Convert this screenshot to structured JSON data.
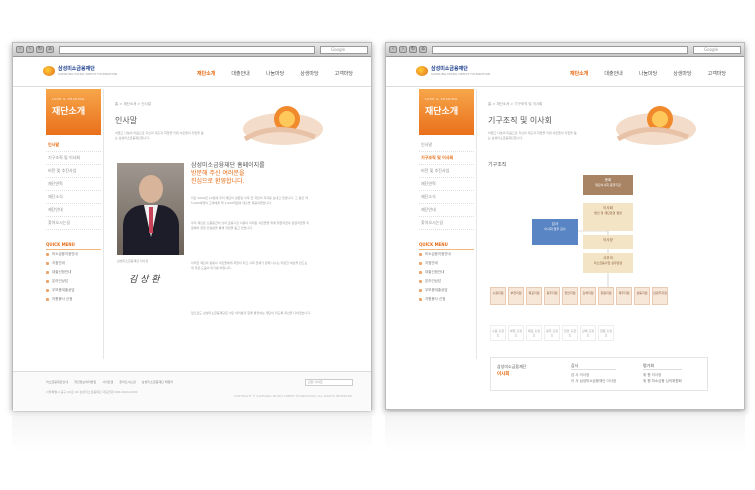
{
  "browser": {
    "search_placeholder": "Google"
  },
  "site": {
    "logo_name": "삼성미소금융재단",
    "logo_sub": "SAMSUNG MICRO CREDIT FOUNDATION",
    "nav": [
      "재단소개",
      "대출안내",
      "나눔마당",
      "상생마당",
      "고객마당"
    ]
  },
  "lnb": {
    "banner_small": "LOVE & SHARING",
    "banner_big": "재단소개",
    "items": [
      "인사말",
      "기구조직 및 이사회",
      "비전 및 추진사업",
      "재단연혁",
      "재단소식",
      "재단안내",
      "찾아오시는길"
    ],
    "quick_title": "QUICK MENU",
    "quick_items": [
      "미소금융지점안내",
      "지점안내",
      "대출신청안내",
      "온라인상담",
      "무보증대출상담",
      "자원봉사 신청"
    ]
  },
  "left_page": {
    "breadcrumb": "홈  >  재단소개  >  인사말",
    "title": "인사말",
    "desc": "어렵고 나눔의 마음으로 자신의 대출과 희망을 키워 서민들의 자립을 돕는 삼성미소금융재단입니다.",
    "photo_caption": "삼성미소금융재단 이사장",
    "signature": "김 상 환",
    "greeting_title": "삼성미소금융재단 홈페이지를",
    "greeting_orange_1": "방문해 주신 여러분을",
    "greeting_orange_2": "진심으로 환영합니다.",
    "paragraphs": [
      "지난 2009년 12월에 우리 재단이 설립된 이후 전 국민이 지지를 보내고 있습니다. 그 동안 약 5,000여명의 고객에게 약 1,000억원의 대출을 제공하였습니다.",
      "우리 재단은 신용등급이 낮아 금융기관 이용이 어려운 서민들을 위해 창업자금과 운영자금을 지원하며 창업 컨설팅을 통해 자립을 돕고 있습니다.",
      "이러한 재단의 활동이 서민들에게 희망이 되고 사회 전체가 함께 나누는 따뜻한 세상을 만드는 데 작은 도움이 되기를 바랍니다.",
      "앞으로도 삼성미소금융재단은 서민 여러분과 함께 발전하는 재단이 되도록 최선을 다하겠습니다.",
      "감사합니다."
    ],
    "footer_links": [
      "미소금융재단안내",
      "개인정보처리방침",
      "사이트맵",
      "찾아오시는길",
      "삼성미소금융재단 패밀리"
    ],
    "footer_addr": "서울특별시 중구 00로 00 삼성미소금융재단 대표전화 000-0000-0000",
    "footer_select": "관련 사이트",
    "footer_copy": "COPYRIGHT © SAMSUNG MICRO CREDIT FOUNDATION. ALL RIGHTS RESERVED."
  },
  "right_page": {
    "breadcrumb": "홈  >  재단소개  >  기구조직 및 이사회",
    "title": "기구조직 및 이사회",
    "desc": "어렵고 나눔의 마음으로 자신의 대출과 희망을 키워 서민들의 자립을 돕는 삼성미소금융재단입니다.",
    "section": "기구조직",
    "boxes": {
      "chairman": "총회",
      "chairman_sub": "재단이사회 총괄기관",
      "auditor": "감사",
      "auditor_sub": "이사회 업무 감사",
      "board": "이사회",
      "board_sub": "법인 및 재단운영 결정",
      "director": "이사장",
      "secretary": "사무국",
      "secretary_sub": "미소금융사업 실무운영"
    },
    "depts": [
      "수원지점",
      "부천지점",
      "목포지점",
      "광주지점",
      "천안지점",
      "김해지점",
      "창원지점",
      "제주지점",
      "성동지점",
      "남양주지점"
    ],
    "sub_depts": [
      "수원 출장소",
      "부천 출장소",
      "목포 출장소",
      "광주 출장소",
      "천안 출장소",
      "김해 출장소",
      "창원 출장소"
    ],
    "panel": {
      "title": "삼성미소금융재단",
      "title_orange": "이사회",
      "col1_head": "감사",
      "col1": [
        "감 사  이사장",
        "이 사  삼성미소금융재단 이사장"
      ],
      "col2_head": "평가회",
      "col2": [
        "위 원  이사장",
        "위 원  미소금융 심의위원회"
      ]
    }
  }
}
